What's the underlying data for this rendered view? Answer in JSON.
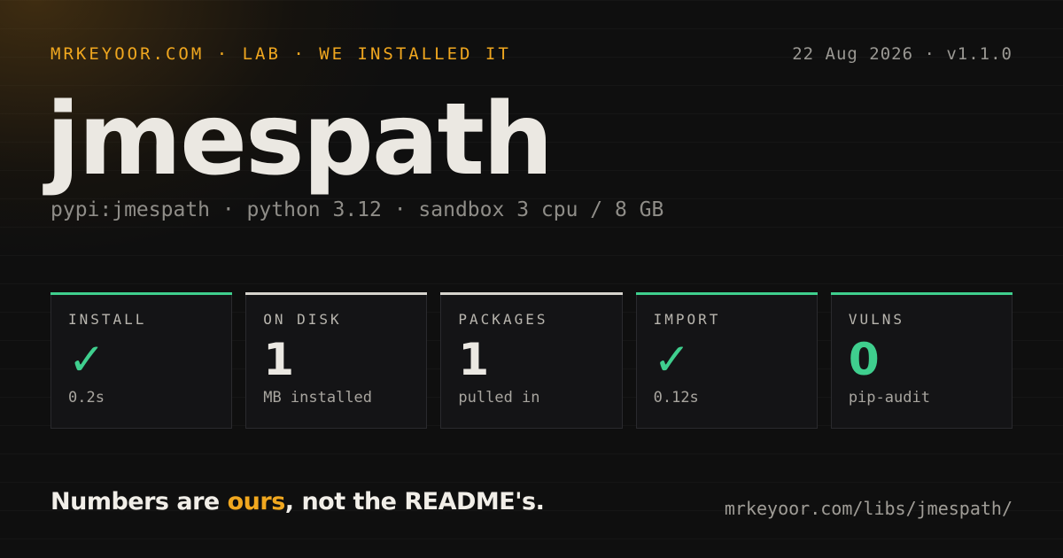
{
  "header": {
    "kicker": "MRKEYOOR.COM · LAB · WE INSTALLED IT",
    "meta": "22 Aug 2026 · v1.1.0"
  },
  "package": {
    "name": "jmespath",
    "details": "pypi:jmespath · python 3.12 · sandbox 3 cpu / 8 GB"
  },
  "stats": [
    {
      "label": "INSTALL",
      "value": "✓",
      "sub": "0.2s",
      "accent_color": "#3fcf8e",
      "value_color": "#3fcf8e"
    },
    {
      "label": "ON DISK",
      "value": "1",
      "sub": "MB installed",
      "accent_color": "#d6d3cd",
      "value_color": "#ebe8e2"
    },
    {
      "label": "PACKAGES",
      "value": "1",
      "sub": "pulled in",
      "accent_color": "#d6d3cd",
      "value_color": "#ebe8e2"
    },
    {
      "label": "IMPORT",
      "value": "✓",
      "sub": "0.12s",
      "accent_color": "#3fcf8e",
      "value_color": "#3fcf8e"
    },
    {
      "label": "VULNS",
      "value": "0",
      "sub": "pip-audit",
      "accent_color": "#3fcf8e",
      "value_color": "#3fcf8e"
    }
  ],
  "footer": {
    "tagline_before": "Numbers are ",
    "tagline_highlight": "ours",
    "tagline_after": ", not the README's.",
    "url": "mrkeyoor.com/libs/jmespath/"
  },
  "colors": {
    "background": "#0f0f0f",
    "accent_orange": "#f0a71f",
    "success_green": "#3fcf8e"
  }
}
